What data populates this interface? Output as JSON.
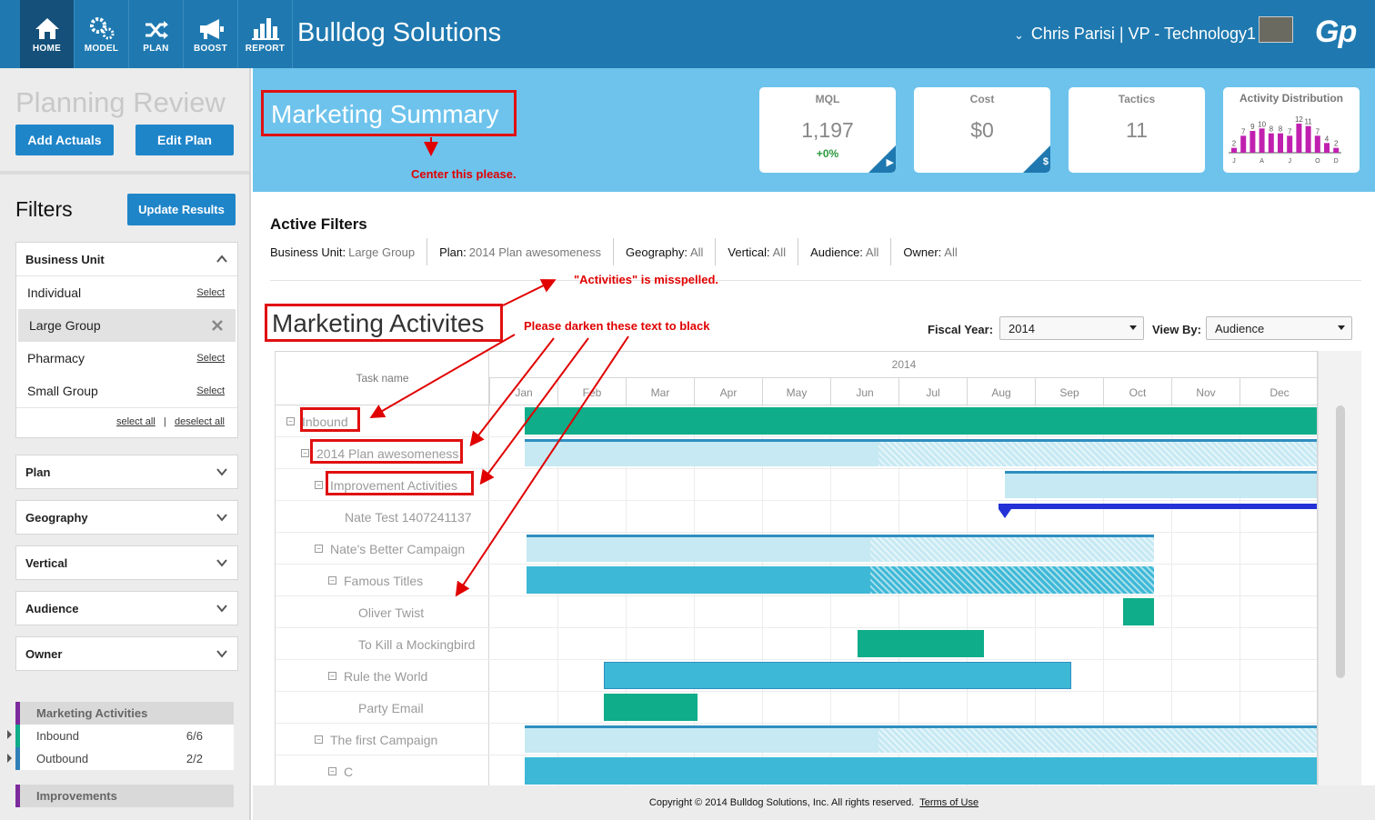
{
  "app": {
    "brand": "Bulldog Solutions",
    "user": "Chris Parisi  |  VP - Technology1",
    "logo": "Gp"
  },
  "nav": [
    {
      "label": "HOME",
      "icon": "home-icon"
    },
    {
      "label": "MODEL",
      "icon": "gears-icon"
    },
    {
      "label": "PLAN",
      "icon": "shuffle-icon"
    },
    {
      "label": "BOOST",
      "icon": "megaphone-icon"
    },
    {
      "label": "REPORT",
      "icon": "bar-chart-icon"
    }
  ],
  "sidebar": {
    "title": "Planning Review",
    "add_actuals": "Add Actuals",
    "edit_plan": "Edit Plan",
    "filters_title": "Filters",
    "update_results": "Update Results",
    "business_unit": {
      "label": "Business Unit",
      "items": [
        {
          "label": "Individual",
          "action": "Select"
        },
        {
          "label": "Large Group",
          "action": ""
        },
        {
          "label": "Pharmacy",
          "action": "Select"
        },
        {
          "label": "Small Group",
          "action": "Select"
        }
      ],
      "select_all": "select all",
      "deselect_all": "deselect all"
    },
    "collapsed_filters": [
      "Plan",
      "Geography",
      "Vertical",
      "Audience",
      "Owner"
    ],
    "legend": {
      "marketing_activities": "Marketing Activities",
      "inbound": "Inbound",
      "inbound_count": "6/6",
      "outbound": "Outbound",
      "outbound_count": "2/2",
      "improvements": "Improvements"
    }
  },
  "summary": {
    "title": "Marketing Summary",
    "cards": {
      "mql": {
        "title": "MQL",
        "value": "1,197",
        "delta": "+0%"
      },
      "cost": {
        "title": "Cost",
        "value": "$0"
      },
      "tactics": {
        "title": "Tactics",
        "value": "11"
      }
    }
  },
  "activity_distribution": {
    "title": "Activity Distribution",
    "bar_labels": [
      "2",
      "7",
      "9",
      "10",
      "8",
      "8",
      "7",
      "12",
      "11",
      "7",
      "4",
      "2"
    ],
    "tick_labels": [
      "J",
      "A",
      "J",
      "O",
      "D"
    ],
    "color": "#c020b0"
  },
  "chart_data": {
    "type": "bar",
    "title": "Activity Distribution",
    "categories": [
      "1",
      "2",
      "3",
      "4",
      "5",
      "6",
      "7",
      "8",
      "9",
      "10",
      "11",
      "12"
    ],
    "values": [
      2,
      7,
      9,
      10,
      8,
      8,
      7,
      12,
      11,
      7,
      4,
      2
    ],
    "x_tick_labels": [
      "J",
      "A",
      "J",
      "O",
      "D"
    ]
  },
  "active_filters": {
    "title": "Active Filters",
    "items": [
      {
        "label": "Business Unit:",
        "value": "Large Group"
      },
      {
        "label": "Plan:",
        "value": "2014 Plan awesomeness"
      },
      {
        "label": "Geography:",
        "value": "All"
      },
      {
        "label": "Vertical:",
        "value": "All"
      },
      {
        "label": "Audience:",
        "value": "All"
      },
      {
        "label": "Owner:",
        "value": "All"
      }
    ]
  },
  "activities": {
    "title": "Marketing Activites",
    "fiscal_year_label": "Fiscal Year:",
    "fiscal_year": "2014",
    "view_by_label": "View By:",
    "view_by": "Audience"
  },
  "gantt": {
    "task_header": "Task name",
    "year": "2014",
    "months": [
      "Jan",
      "Feb",
      "Mar",
      "Apr",
      "May",
      "Jun",
      "Jul",
      "Aug",
      "Sep",
      "Oct",
      "Nov",
      "Dec"
    ],
    "colors": {
      "green": "#0fad8a",
      "light": "#c6e9f3",
      "teal": "#3db8d6",
      "blue": "#2432d6"
    },
    "rows": [
      {
        "name": "Inbound",
        "level": 0,
        "toggle": true
      },
      {
        "name": "2014 Plan awesomeness",
        "level": 1,
        "toggle": true
      },
      {
        "name": "Improvement Activities",
        "level": 2,
        "toggle": true
      },
      {
        "name": "Nate Test 1407241137",
        "level": 3,
        "toggle": false
      },
      {
        "name": "Nate's Better Campaign",
        "level": 2,
        "toggle": true
      },
      {
        "name": "Famous Titles",
        "level": 3,
        "toggle": true
      },
      {
        "name": "Oliver Twist",
        "level": 4,
        "toggle": false
      },
      {
        "name": "To Kill a Mockingbird",
        "level": 4,
        "toggle": false
      },
      {
        "name": "Rule the World",
        "level": 3,
        "toggle": true
      },
      {
        "name": "Party Email",
        "level": 4,
        "toggle": false
      },
      {
        "name": "The first Campaign",
        "level": 2,
        "toggle": true
      },
      {
        "name": "C",
        "level": 3,
        "toggle": true
      }
    ]
  },
  "annotations": {
    "center": "Center this please.",
    "misspelled": "\"Activities\" is misspelled.",
    "darken": "Please darken these text to black"
  },
  "footer": {
    "copyright": "Copyright © 2014 Bulldog Solutions, Inc. All rights reserved.",
    "terms": "Terms of Use"
  }
}
